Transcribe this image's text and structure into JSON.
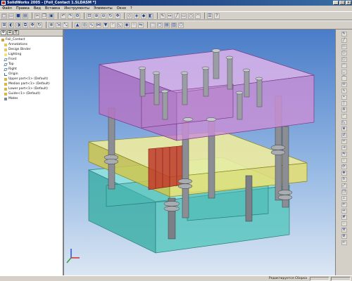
{
  "window": {
    "title": "SolidWorks 2005 - [Foil_Contact 1.SLDASM *]",
    "controls": [
      "_",
      "□",
      "×"
    ]
  },
  "menubar": {
    "items": [
      "Файл",
      "Правка",
      "Вид",
      "Вставка",
      "Инструменты",
      "Элементы",
      "Окно",
      "?"
    ]
  },
  "feature_manager": {
    "tabs": [
      "feature-tree",
      "property",
      "configuration"
    ],
    "tree": [
      {
        "label": "Foil_Contact",
        "icon": "assembly-icon"
      },
      {
        "label": "Annotations",
        "icon": "annotations-icon"
      },
      {
        "label": "Design Binder",
        "icon": "folder-icon"
      },
      {
        "label": "Lighting",
        "icon": "lighting-icon"
      },
      {
        "label": "Front",
        "icon": "plane-icon"
      },
      {
        "label": "Top",
        "icon": "plane-icon"
      },
      {
        "label": "Right",
        "icon": "plane-icon"
      },
      {
        "label": "Origin",
        "icon": "origin-icon"
      },
      {
        "label": "Upper part<1> (Default)",
        "icon": "part-icon"
      },
      {
        "label": "Median part<1> (Default)",
        "icon": "part-icon"
      },
      {
        "label": "Lower part<1> (Default)",
        "icon": "part-icon"
      },
      {
        "label": "Guide<1> (Default)",
        "icon": "part-icon"
      },
      {
        "label": "Mates",
        "icon": "mates-icon"
      }
    ]
  },
  "viewport": {
    "background_top": "#4a7cc8",
    "background_bottom": "#dbe6f3",
    "components": [
      {
        "name": "upper-plate",
        "color": "#c98fd6"
      },
      {
        "name": "median-plate",
        "color": "#e8e070"
      },
      {
        "name": "lower-plate",
        "color": "#5cc8c0"
      },
      {
        "name": "contact-part",
        "color": "#c0392b"
      }
    ],
    "triad_axes": {
      "x": "#d03030",
      "y": "#30a030",
      "z": "#3050d0"
    }
  },
  "statusbar": {
    "text": "Редактируется Сборка"
  }
}
